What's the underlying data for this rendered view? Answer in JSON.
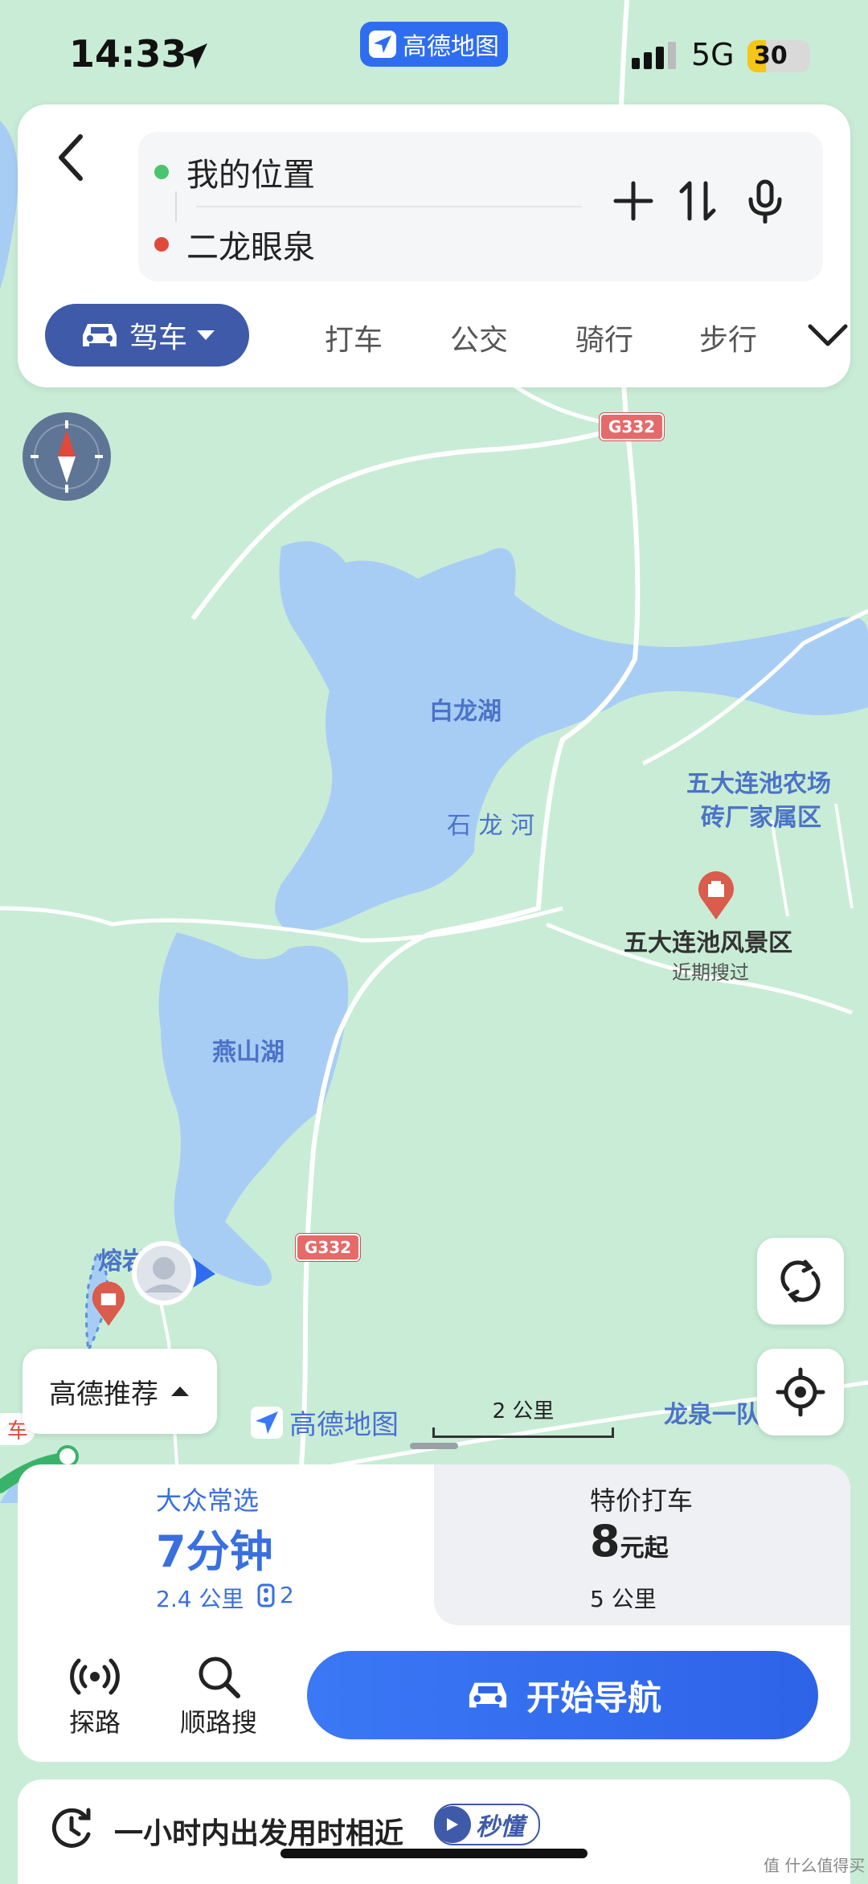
{
  "status": {
    "time": "14:33",
    "network": "5G",
    "battery": "30",
    "battery_level": 0.3,
    "app_pill": "高德地图"
  },
  "route": {
    "from": "我的位置",
    "to": "二龙眼泉"
  },
  "modes": {
    "active": "驾车",
    "items": [
      "打车",
      "公交",
      "骑行",
      "步行"
    ]
  },
  "map": {
    "lakes": [
      "白龙湖",
      "燕山湖"
    ],
    "river": "石 龙 河",
    "roads": [
      "G332",
      "G332"
    ],
    "poi_farm": [
      "五大连池农场",
      "砖厂家属区"
    ],
    "poi_scenic": "五大连池风景区",
    "poi_scenic_sub": "近期搜过",
    "partial_label_1": "熔岩",
    "partial_label_2": "龙泉一队",
    "partial_label_3": "车",
    "watermark": "高德地图",
    "scale": "2 公里"
  },
  "recommend": {
    "label": "高德推荐"
  },
  "options": [
    {
      "title": "大众常选",
      "main": "7分钟",
      "sub": "2.4 公里",
      "lights": "2"
    },
    {
      "title": "特价打车",
      "main_num": "8",
      "main_unit": "元起",
      "sub": "5 公里"
    }
  ],
  "tools": {
    "explore": "探路",
    "search": "顺路搜"
  },
  "navigate": "开始导航",
  "tip": {
    "text": "一小时内出发用时相近",
    "badge": "秒懂"
  },
  "corner_watermark": "值 什么值得买",
  "colors": {
    "accent": "#2f6df0",
    "active_mode": "#3e5aa8",
    "map_bg": "#c9ecd6",
    "water": "#a8cdf5",
    "origin": "#4cc46f",
    "destination": "#e04a3a"
  }
}
